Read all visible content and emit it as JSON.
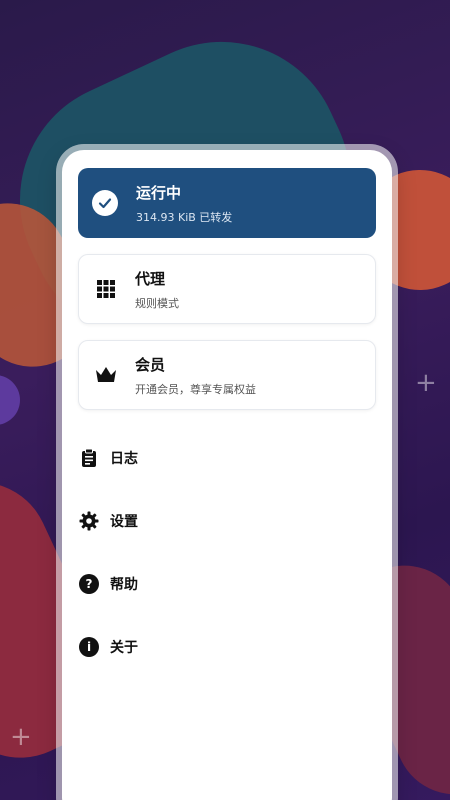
{
  "status": {
    "title": "运行中",
    "subtitle": "314.93 KiB 已转发",
    "icon": "check-icon"
  },
  "proxy": {
    "title": "代理",
    "subtitle": "规则模式",
    "icon": "grid-icon"
  },
  "member": {
    "title": "会员",
    "subtitle": "开通会员，尊享专属权益",
    "icon": "crown-icon"
  },
  "menu": [
    {
      "label": "日志",
      "icon": "clipboard-icon"
    },
    {
      "label": "设置",
      "icon": "gear-icon"
    },
    {
      "label": "帮助",
      "icon": "question-icon"
    },
    {
      "label": "关于",
      "icon": "info-icon"
    }
  ],
  "colors": {
    "status_bg": "#1f4f7f",
    "card_bg": "#ffffff"
  }
}
